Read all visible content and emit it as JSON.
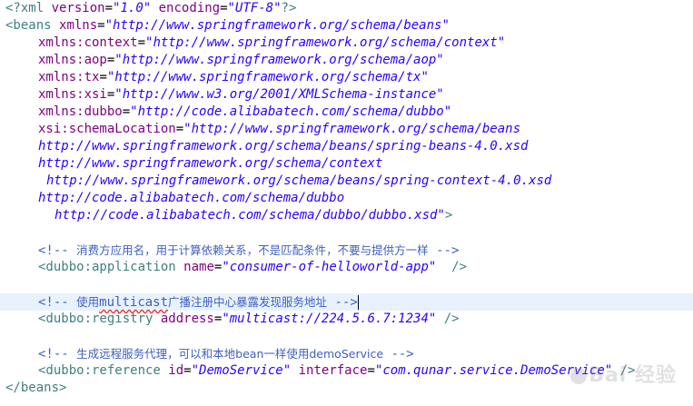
{
  "lines": {
    "l1": {
      "a": "<?xml ",
      "b": "version",
      "c": "=",
      "d": "\"1.0\"",
      "e": " ",
      "f": "encoding",
      "g": "=",
      "h": "\"UTF-8\"",
      "i": "?>"
    },
    "l2": {
      "a": "<beans ",
      "b": "xmlns",
      "c": "=",
      "d": "\"http://www.springframework.org/schema/beans\""
    },
    "l3": {
      "a": "xmlns:context",
      "b": "=",
      "c": "\"http://www.springframework.org/schema/context\""
    },
    "l4": {
      "a": "xmlns:aop",
      "b": "=",
      "c": "\"http://www.springframework.org/schema/aop\""
    },
    "l5": {
      "a": "xmlns:tx",
      "b": "=",
      "c": "\"http://www.springframework.org/schema/tx\""
    },
    "l6": {
      "a": "xmlns:xsi",
      "b": "=",
      "c": "\"http://www.w3.org/2001/XMLSchema-instance\""
    },
    "l7": {
      "a": "xmlns:dubbo",
      "b": "=",
      "c": "\"http://code.alibabatech.com/schema/dubbo\""
    },
    "l8": {
      "a": "xsi:schemaLocation",
      "b": "=",
      "c": "\"http://www.springframework.org/schema/beans"
    },
    "l9": {
      "a": "http://www.springframework.org/schema/beans/spring-beans-4.0.xsd"
    },
    "l10": {
      "a": "http://www.springframework.org/schema/context"
    },
    "l11": {
      "a": "http://www.springframework.org/schema/beans/spring-context-4.0.xsd"
    },
    "l12": {
      "a": "http://code.alibabatech.com/schema/dubbo"
    },
    "l13": {
      "a": "http://code.alibabatech.com/schema/dubbo/dubbo.xsd\"",
      "b": ">"
    },
    "l15": {
      "a": "<!-- ",
      "b": "消费方应用名，用于计算依赖关系，不是匹配条件，不要与提供方一样",
      "c": " -->"
    },
    "l16": {
      "a": "<dubbo:application ",
      "b": "name",
      "c": "=",
      "d": "\"consumer-of-helloworld-app\"",
      "e": "  />"
    },
    "l18": {
      "a": "<!-- ",
      "b": "使用",
      "c": "multicast",
      "d": "广播注册中心暴露发现服务地址",
      "e": " -->"
    },
    "l19": {
      "a": "<dubbo:registry ",
      "b": "address",
      "c": "=",
      "d": "\"multicast://224.5.6.7:1234\"",
      "e": " />"
    },
    "l21": {
      "a": "<!-- ",
      "b": "生成远程服务代理，可以和本地bean一样使用demoService",
      "c": " -->"
    },
    "l22": {
      "a": "<dubbo:reference ",
      "b": "id",
      "c": "=",
      "d": "\"DemoService\"",
      "e": " ",
      "f": "interface",
      "g": "=",
      "h": "\"com.qunar.service.DemoService\"",
      "i": " />"
    },
    "l23": {
      "a": "</beans>"
    }
  },
  "watermark": "Bai 经验",
  "colors": {
    "tag": "#3f7f7f",
    "attribute": "#7f007f",
    "value": "#2a00ff",
    "comment": "#3f5fbf",
    "current_line": "#e8f2fe"
  }
}
